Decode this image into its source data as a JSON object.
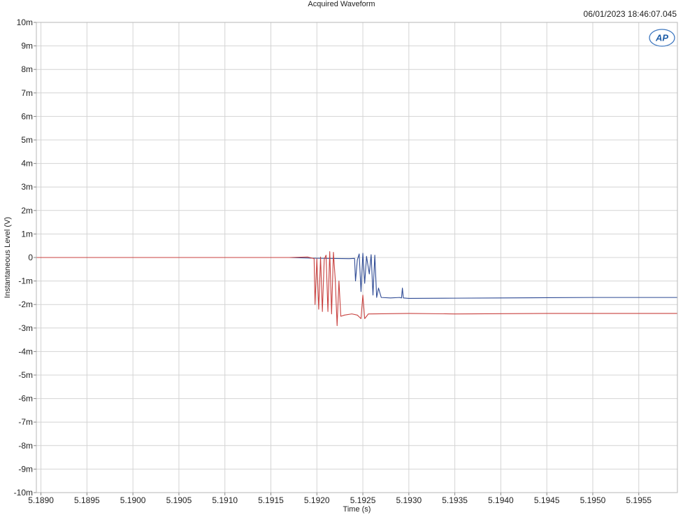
{
  "title": "Acquired Waveform",
  "timestamp": "06/01/2023 18:46:07.045",
  "logo_text": "AP",
  "chart_data": {
    "type": "line",
    "title": "Acquired Waveform",
    "xlabel": "Time (s)",
    "ylabel": "Instantaneous Level (V)",
    "xlim": [
      5.18895,
      5.19592
    ],
    "ylim": [
      -10,
      10
    ],
    "y_unit": "mV",
    "grid": true,
    "legend": "none",
    "x_ticks": [
      5.189,
      5.1895,
      5.19,
      5.1905,
      5.191,
      5.1915,
      5.192,
      5.1925,
      5.193,
      5.1935,
      5.194,
      5.1945,
      5.195,
      5.1955
    ],
    "x_tick_labels": [
      "5.1890",
      "5.1895",
      "5.1900",
      "5.1905",
      "5.1910",
      "5.1915",
      "5.1920",
      "5.1925",
      "5.1930",
      "5.1935",
      "5.1940",
      "5.1945",
      "5.1950",
      "5.1955"
    ],
    "y_ticks": [
      10,
      9,
      8,
      7,
      6,
      5,
      4,
      3,
      2,
      1,
      0,
      -1,
      -2,
      -3,
      -4,
      -5,
      -6,
      -7,
      -8,
      -9,
      -10
    ],
    "y_tick_labels": [
      "10m",
      "9m",
      "8m",
      "7m",
      "6m",
      "5m",
      "4m",
      "3m",
      "2m",
      "1m",
      "0",
      "-1m",
      "-2m",
      "-3m",
      "-4m",
      "-5m",
      "-6m",
      "-7m",
      "-8m",
      "-9m",
      "-10m"
    ],
    "series": [
      {
        "color": "#2e4a94",
        "points": [
          [
            5.18895,
            0.0
          ],
          [
            5.1917,
            0.0
          ],
          [
            5.19195,
            -0.03
          ],
          [
            5.19235,
            -0.05
          ],
          [
            5.19241,
            -0.04
          ],
          [
            5.19242,
            -1.0
          ],
          [
            5.19244,
            -0.1
          ],
          [
            5.19246,
            0.15
          ],
          [
            5.19248,
            -1.45
          ],
          [
            5.1925,
            0.18
          ],
          [
            5.19252,
            -1.1
          ],
          [
            5.19254,
            0.05
          ],
          [
            5.19257,
            -0.7
          ],
          [
            5.19259,
            0.12
          ],
          [
            5.19261,
            -1.6
          ],
          [
            5.19263,
            0.1
          ],
          [
            5.19265,
            -1.7
          ],
          [
            5.19267,
            -1.3
          ],
          [
            5.1927,
            -1.7
          ],
          [
            5.1928,
            -1.72
          ],
          [
            5.1929,
            -1.7
          ],
          [
            5.19292,
            -1.72
          ],
          [
            5.19293,
            -1.3
          ],
          [
            5.19294,
            -1.72
          ],
          [
            5.193,
            -1.74
          ],
          [
            5.1935,
            -1.73
          ],
          [
            5.194,
            -1.72
          ],
          [
            5.1945,
            -1.71
          ],
          [
            5.195,
            -1.7
          ],
          [
            5.1955,
            -1.7
          ],
          [
            5.19592,
            -1.7
          ]
        ]
      },
      {
        "color": "#c8413f",
        "points": [
          [
            5.18895,
            0.0
          ],
          [
            5.1917,
            0.0
          ],
          [
            5.1919,
            0.02
          ],
          [
            5.19197,
            -0.05
          ],
          [
            5.19198,
            -2.0
          ],
          [
            5.192,
            -0.05
          ],
          [
            5.19202,
            -2.2
          ],
          [
            5.19204,
            0.02
          ],
          [
            5.19206,
            -2.3
          ],
          [
            5.19208,
            -0.08
          ],
          [
            5.1921,
            0.1
          ],
          [
            5.19212,
            -2.3
          ],
          [
            5.19214,
            0.25
          ],
          [
            5.19216,
            -2.4
          ],
          [
            5.19218,
            0.22
          ],
          [
            5.1922,
            -0.95
          ],
          [
            5.19222,
            -2.9
          ],
          [
            5.19224,
            -1.0
          ],
          [
            5.19226,
            -2.5
          ],
          [
            5.1923,
            -2.45
          ],
          [
            5.19238,
            -2.4
          ],
          [
            5.19244,
            -2.45
          ],
          [
            5.19248,
            -2.6
          ],
          [
            5.1925,
            -1.6
          ],
          [
            5.19252,
            -2.6
          ],
          [
            5.19256,
            -2.4
          ],
          [
            5.193,
            -2.38
          ],
          [
            5.1935,
            -2.4
          ],
          [
            5.194,
            -2.39
          ],
          [
            5.1945,
            -2.38
          ],
          [
            5.195,
            -2.38
          ],
          [
            5.1955,
            -2.38
          ],
          [
            5.19592,
            -2.38
          ]
        ]
      }
    ]
  }
}
